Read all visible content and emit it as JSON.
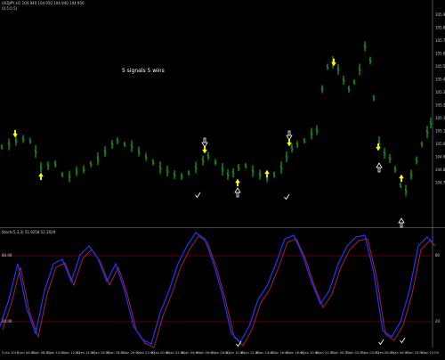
{
  "window": {
    "header_line1": "USDJPY,H1 104.940 104.950 104.940 104.950",
    "header_line2": "(0.5:0.5)"
  },
  "main_chart": {
    "annotation": "5 signals 5 wins",
    "price_ticks": [
      "105.910",
      "105.820",
      "105.730",
      "105.640",
      "105.550",
      "105.460",
      "105.370",
      "105.280",
      "105.190",
      "105.100",
      "105.010",
      "104.920",
      "104.830",
      "104.740"
    ],
    "bar_color": "#22dd22",
    "signal_color": "#ffff00",
    "exit_color": "#ffffff"
  },
  "indicator": {
    "label": "Stoch(5,3,3) 51.9258 52.3029",
    "level_high": "80",
    "level_low": "20",
    "level_high_text": "80.00",
    "level_low_text": "20.00",
    "line_main_color": "#2233ff",
    "line_signal_color": "#a02040",
    "level_color": "#7a0000"
  },
  "time_axis": {
    "labels": [
      "2 Jan 2015",
      "5 Jan 06:00",
      "5 Jan 08:00",
      "5 Jan 10:00",
      "5 Jan 12:00",
      "5 Jan 14:00",
      "5 Jan 16:00",
      "5 Jan 18:00",
      "5 Jan 20:00",
      "5 Jan 22:00",
      "6 Jan 00:00",
      "6 Jan 02:00",
      "6 Jan 04:00",
      "6 Jan 06:00",
      "6 Jan 08:00",
      "6 Jan 10:00",
      "6 Jan 12:00",
      "6 Jan 14:00",
      "6 Jan 16:00",
      "6 Jan 18:00",
      "6 Jan 20:00",
      "6 Jan 22:00",
      "7 Jan 00:00",
      "7 Jan 02:00",
      "7 Jan 04:00",
      "7 Jan 06:00",
      "7 Jan 08:00",
      "7 Jan 10:00",
      "7 Jan 12:00"
    ]
  }
}
